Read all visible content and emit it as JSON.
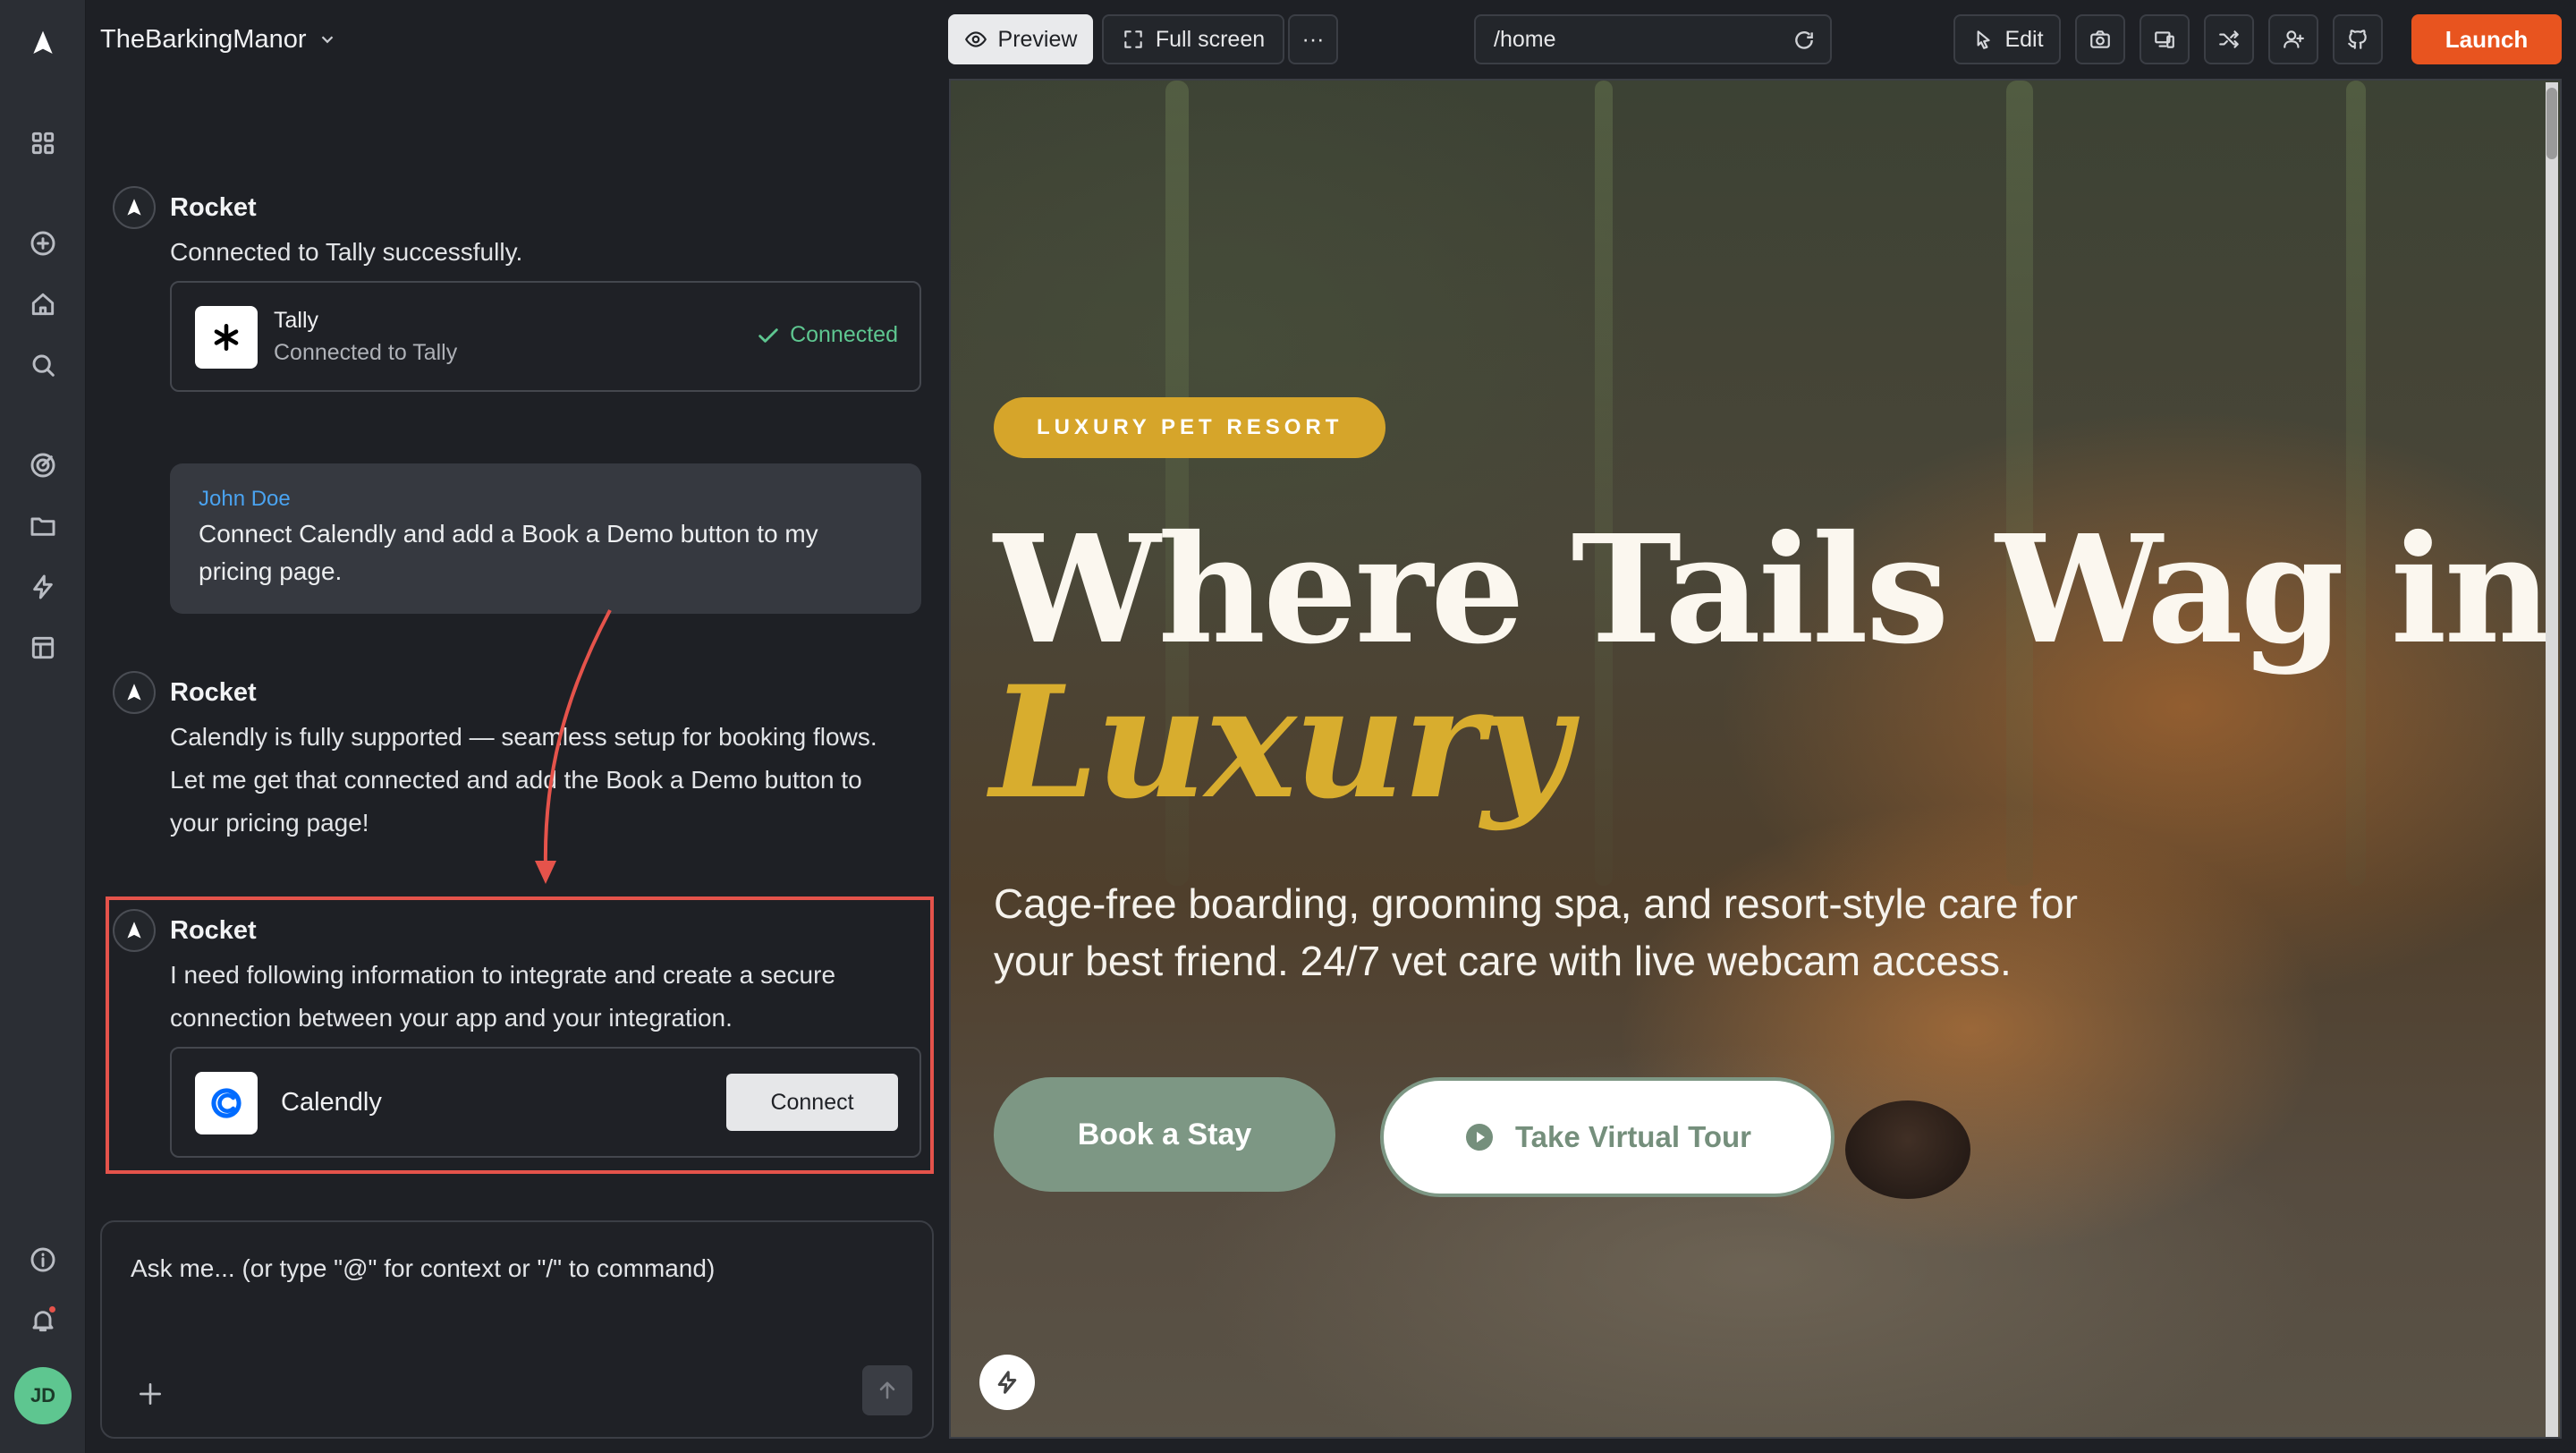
{
  "project": {
    "name": "TheBarkingManor"
  },
  "toolbar": {
    "preview_label": "Preview",
    "fullscreen_label": "Full screen",
    "more_label": "···",
    "url": "/home",
    "edit_label": "Edit",
    "launch_label": "Launch"
  },
  "chat": {
    "messages": [
      {
        "author": "Rocket",
        "text": "Connected to Tally successfully."
      },
      {
        "author": "Rocket",
        "lines": [
          "Calendly is fully supported — seamless setup for booking flows.",
          "Let me get that connected and add the Book a Demo button to",
          "your pricing page!"
        ]
      },
      {
        "author": "Rocket",
        "lines": [
          "I need following information to integrate and create a secure",
          "connection between your app and your integration."
        ]
      }
    ],
    "tally_card": {
      "name": "Tally",
      "subtitle": "Connected to Tally",
      "status": "Connected"
    },
    "user_message": {
      "author": "John Doe",
      "lines": [
        "Connect Calendly and add a Book a Demo button to my",
        "pricing page."
      ]
    },
    "calendly_card": {
      "name": "Calendly",
      "button": "Connect"
    },
    "composer": {
      "placeholder": "Ask me... (or type \"@\" for context or \"/\" to command)"
    }
  },
  "user": {
    "initials": "JD"
  },
  "site": {
    "badge": "LUXURY PET RESORT",
    "headline_1": "Where Tails Wag in",
    "headline_2": "Luxury",
    "subtitle_lines": [
      "Cage-free boarding, grooming spa, and resort-style care for",
      "your best friend. 24/7 vet care with live webcam access."
    ],
    "primary_cta": "Book a Stay",
    "secondary_cta": "Take Virtual Tour"
  },
  "colors": {
    "accent": "#e8541f",
    "highlight": "#e5534b",
    "connected": "#5ec690",
    "gold": "#d6a52a",
    "sage": "#7d9784"
  }
}
